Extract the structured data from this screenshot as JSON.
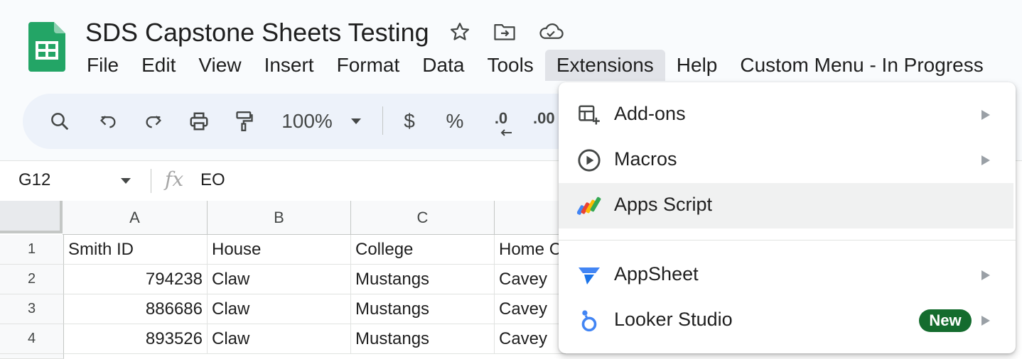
{
  "document": {
    "title": "SDS Capstone Sheets Testing"
  },
  "menubar": {
    "items": [
      {
        "label": "File"
      },
      {
        "label": "Edit"
      },
      {
        "label": "View"
      },
      {
        "label": "Insert"
      },
      {
        "label": "Format"
      },
      {
        "label": "Data"
      },
      {
        "label": "Tools"
      },
      {
        "label": "Extensions",
        "active": true
      },
      {
        "label": "Help"
      },
      {
        "label": "Custom Menu - In Progress"
      }
    ]
  },
  "toolbar": {
    "zoom": "100%",
    "currency_symbol": "$",
    "percent_symbol": "%",
    "decrease_decimal": ".0",
    "increase_decimal": ".00"
  },
  "formula_bar": {
    "cell_ref": "G12",
    "fx_symbol": "fx",
    "value": "EO"
  },
  "grid": {
    "columns": [
      "A",
      "B",
      "C"
    ],
    "rows": [
      {
        "num": "1",
        "cells": [
          "Smith ID",
          "House",
          "College",
          "Home C"
        ]
      },
      {
        "num": "2",
        "cells": [
          "794238",
          "Claw",
          "Mustangs",
          "Cavey"
        ]
      },
      {
        "num": "3",
        "cells": [
          "886686",
          "Claw",
          "Mustangs",
          "Cavey"
        ]
      },
      {
        "num": "4",
        "cells": [
          "893526",
          "Claw",
          "Mustangs",
          "Cavey"
        ]
      }
    ]
  },
  "extensions_menu": {
    "items": [
      {
        "label": "Add-ons",
        "icon": "add-ons-icon",
        "submenu": true
      },
      {
        "label": "Macros",
        "icon": "macros-play-icon",
        "submenu": true
      },
      {
        "label": "Apps Script",
        "icon": "apps-script-icon",
        "submenu": false,
        "highlighted": true
      },
      {
        "label": "AppSheet",
        "icon": "appsheet-icon",
        "submenu": true
      },
      {
        "label": "Looker Studio",
        "icon": "looker-studio-icon",
        "submenu": true,
        "badge": "New"
      }
    ]
  },
  "colors": {
    "sheets_green": "#23a566",
    "badge_green": "#146c2e",
    "toolbar_bg": "#edf2fa",
    "menu_hover": "#f0f1f1"
  }
}
